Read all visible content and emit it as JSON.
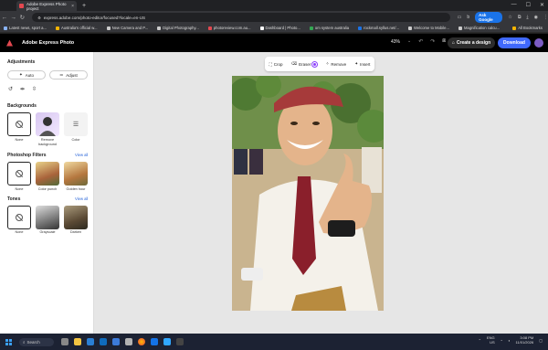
{
  "browser": {
    "tab_title": "Adobe Express Photo project",
    "url": "express.adobe.com/photo-editor/focused?locale=en-US",
    "ask_google": "Ask Google",
    "bookmarks": [
      "Latest news, sport a...",
      "Australia's official w...",
      "New Camera and P...",
      "Digital Photography...",
      "photoreview.com.au...",
      "Dashboard | Photo...",
      "om system australia",
      "rockmall.syllus.net/...",
      "Welcome to Mobile...",
      "Magnification calcu..."
    ],
    "all_bookmarks": "All Bookmarks"
  },
  "app": {
    "name": "Adobe Express Photo",
    "zoom": "43%",
    "create_label": "Create a design",
    "download_label": "Download",
    "accent": "#4069fd"
  },
  "panel": {
    "adjustments_title": "Adjustments",
    "auto_label": "Auto",
    "adjust_label": "Adjust",
    "backgrounds_title": "Backgrounds",
    "backgrounds": [
      "None",
      "Remove background",
      "Color"
    ],
    "filters_title": "Photoshop Filters",
    "filters_view_all": "View all",
    "filters": [
      "None",
      "Color punch",
      "Golden hour"
    ],
    "tones_title": "Tones",
    "tones_view_all": "View all",
    "tones": [
      "None",
      "Grayscale",
      "Darken"
    ]
  },
  "toolbar": {
    "crop": "Crop",
    "eraser": "Eraser",
    "remove": "Remove",
    "insert": "Insert"
  },
  "taskbar": {
    "search": "Search",
    "lang": "ENG",
    "region": "US",
    "time": "3:08 PM",
    "date": "11/01/2026"
  }
}
